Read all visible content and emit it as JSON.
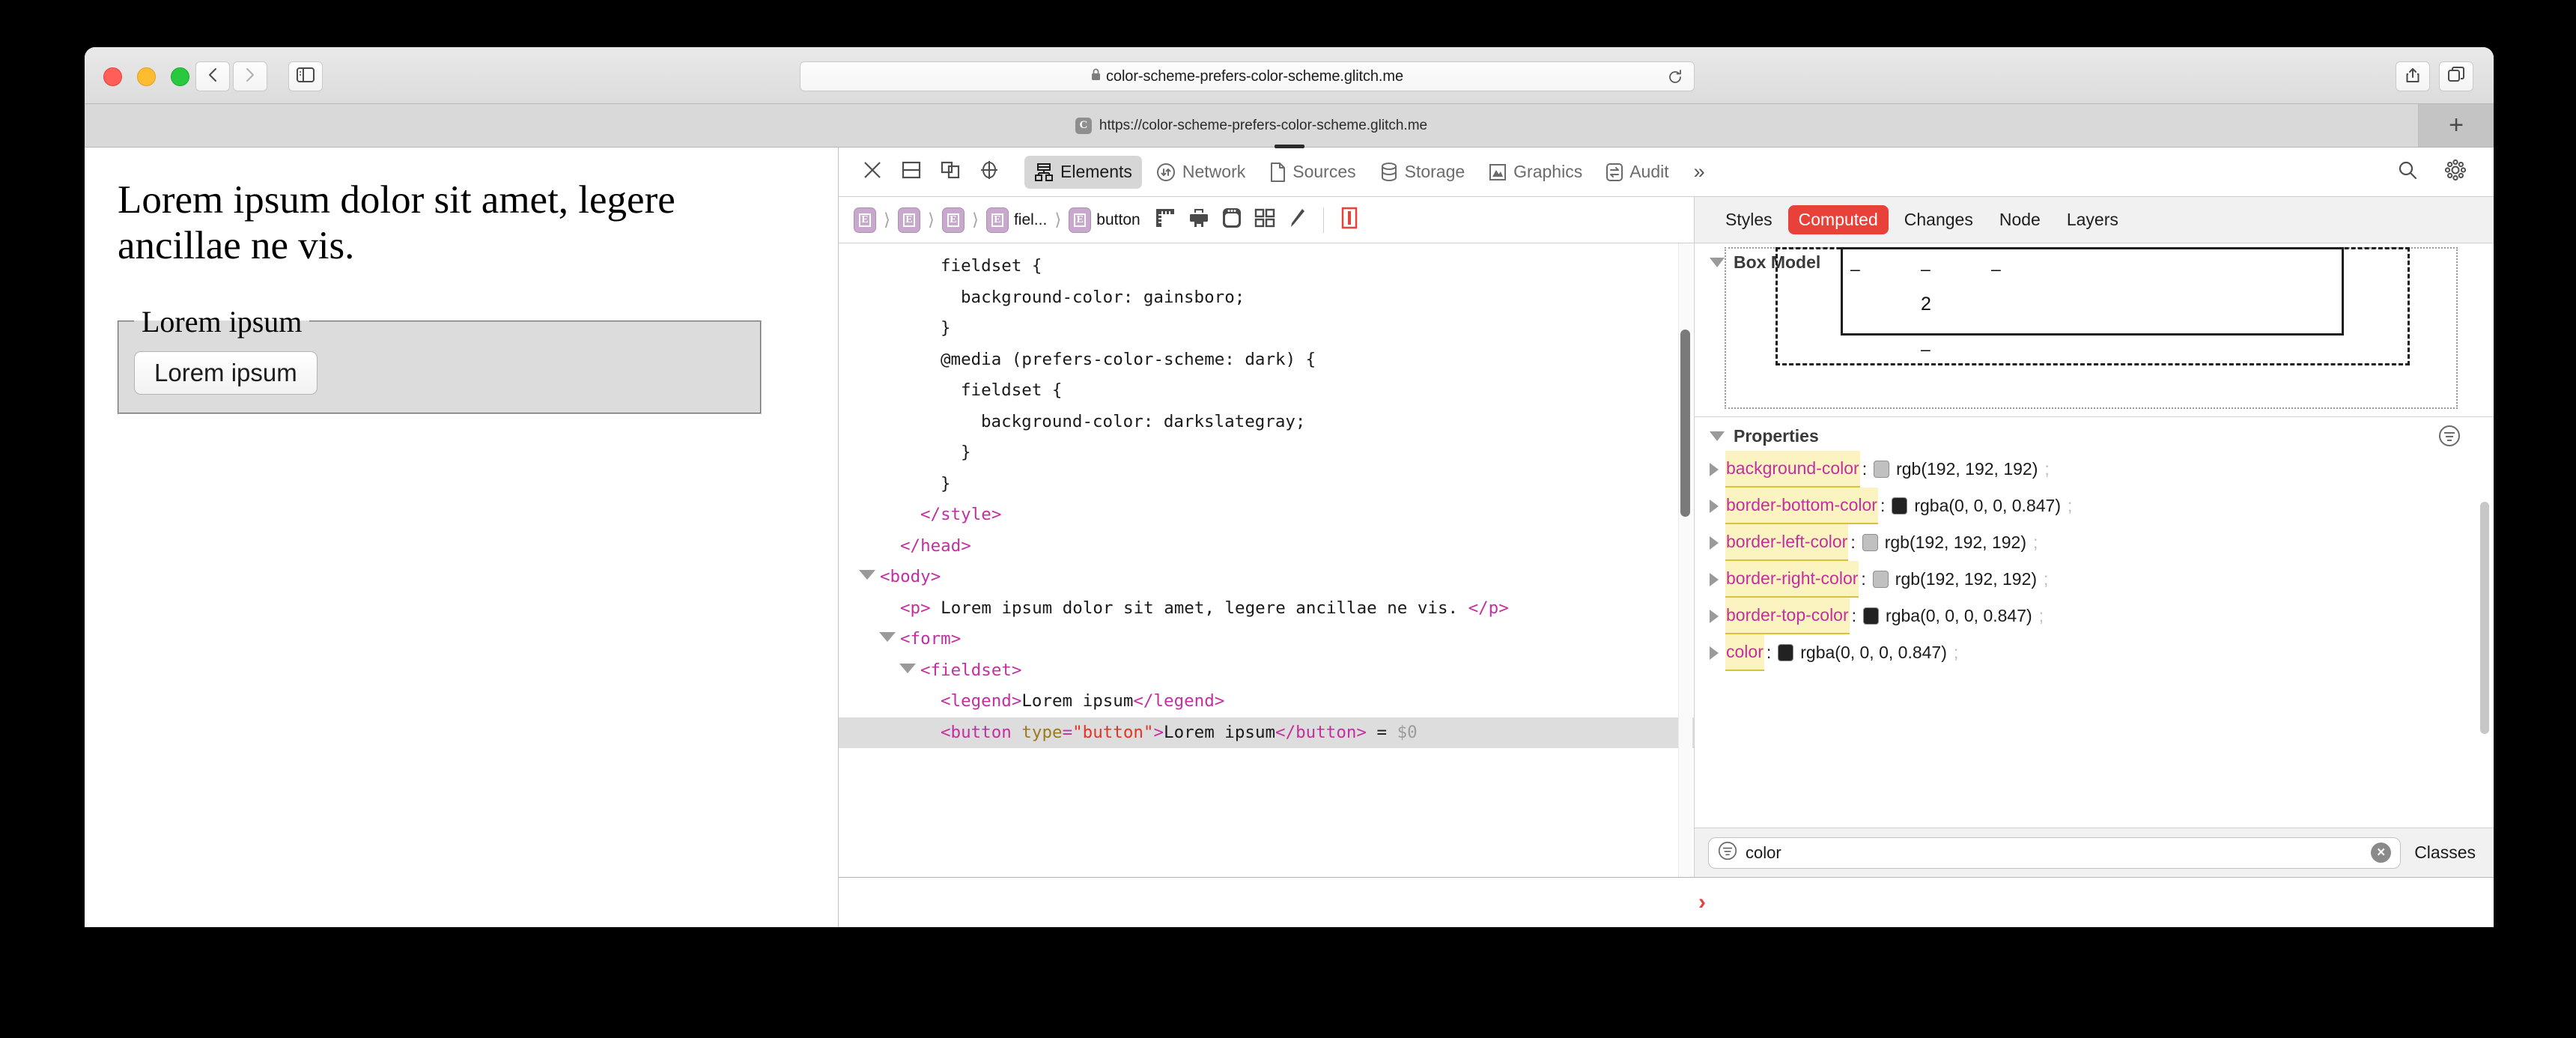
{
  "browser": {
    "address": "color-scheme-prefers-color-scheme.glitch.me",
    "lock_icon": "lock-icon",
    "reload_icon": "reload-icon",
    "back_icon": "chevron-left-icon",
    "forward_icon": "chevron-right-icon",
    "sidebar_icon": "sidebar-toggle-icon",
    "share_icon": "share-icon",
    "tabs_overview_icon": "tab-overview-icon",
    "new_tab_label": "+"
  },
  "tabstrip": {
    "tab": {
      "favicon_letter": "C",
      "title": "https://color-scheme-prefers-color-scheme.glitch.me"
    }
  },
  "page": {
    "paragraph": "Lorem ipsum dolor sit amet, legere ancillae ne vis.",
    "legend": "Lorem ipsum",
    "button_label": "Lorem ipsum"
  },
  "devtools": {
    "toolbar_icons": [
      {
        "name": "close-devtools-icon",
        "glyph": "close"
      },
      {
        "name": "dock-bottom-icon",
        "glyph": "dock-bottom"
      },
      {
        "name": "dock-side-icon",
        "glyph": "dock-side"
      },
      {
        "name": "inspect-element-icon",
        "glyph": "crosshair"
      }
    ],
    "tabs": [
      {
        "label": "Elements",
        "icon": "elements-icon",
        "active": true
      },
      {
        "label": "Network",
        "icon": "network-icon",
        "active": false
      },
      {
        "label": "Sources",
        "icon": "sources-icon",
        "active": false
      },
      {
        "label": "Storage",
        "icon": "storage-icon",
        "active": false
      },
      {
        "label": "Graphics",
        "icon": "graphics-icon",
        "active": false
      },
      {
        "label": "Audit",
        "icon": "audit-icon",
        "active": false
      }
    ],
    "more_label": "»",
    "search_icon": "search-icon",
    "settings_icon": "gear-icon",
    "breadcrumb": [
      {
        "badge": "E",
        "label": ""
      },
      {
        "badge": "E",
        "label": ""
      },
      {
        "badge": "E",
        "label": ""
      },
      {
        "badge": "E",
        "label": "fiel..."
      },
      {
        "badge": "E",
        "label": "button"
      }
    ],
    "breadcrumb_tools": [
      {
        "name": "layout-ruler-icon"
      },
      {
        "name": "print-icon"
      },
      {
        "name": "device-icon"
      },
      {
        "name": "grid-overlay-icon"
      },
      {
        "name": "paintbrush-icon"
      },
      {
        "name": "force-state-icon"
      }
    ],
    "style_tabs": [
      {
        "label": "Styles",
        "active": false
      },
      {
        "label": "Computed",
        "active": true
      },
      {
        "label": "Changes",
        "active": false
      },
      {
        "label": "Node",
        "active": false
      },
      {
        "label": "Layers",
        "active": false
      }
    ],
    "code_lines": [
      {
        "indent": 4,
        "segments": [
          {
            "t": "txt",
            "v": "fieldset {"
          }
        ]
      },
      {
        "indent": 5,
        "segments": [
          {
            "t": "txt",
            "v": "background-color: gainsboro;"
          }
        ]
      },
      {
        "indent": 4,
        "segments": [
          {
            "t": "txt",
            "v": "}"
          }
        ]
      },
      {
        "indent": 4,
        "segments": [
          {
            "t": "txt",
            "v": "@media (prefers-color-scheme: dark) {"
          }
        ]
      },
      {
        "indent": 5,
        "segments": [
          {
            "t": "txt",
            "v": "fieldset {"
          }
        ]
      },
      {
        "indent": 6,
        "segments": [
          {
            "t": "txt",
            "v": "background-color: darkslategray;"
          }
        ]
      },
      {
        "indent": 5,
        "segments": [
          {
            "t": "txt",
            "v": "}"
          }
        ]
      },
      {
        "indent": 4,
        "segments": [
          {
            "t": "txt",
            "v": "}"
          }
        ]
      },
      {
        "indent": 3,
        "segments": [
          {
            "t": "tag",
            "v": "</style>"
          }
        ]
      },
      {
        "indent": 2,
        "segments": [
          {
            "t": "tag",
            "v": "</head>"
          }
        ]
      },
      {
        "indent": 1,
        "triangle": true,
        "segments": [
          {
            "t": "tag",
            "v": "<body>"
          }
        ]
      },
      {
        "indent": 2,
        "segments": [
          {
            "t": "tag",
            "v": "<p>"
          },
          {
            "t": "txt",
            "v": " Lorem ipsum dolor sit amet, legere ancillae ne vis. "
          },
          {
            "t": "tag",
            "v": "</p>"
          }
        ]
      },
      {
        "indent": 2,
        "triangle": true,
        "segments": [
          {
            "t": "tag",
            "v": "<form>"
          }
        ]
      },
      {
        "indent": 3,
        "triangle": true,
        "segments": [
          {
            "t": "tag",
            "v": "<fieldset>"
          }
        ]
      },
      {
        "indent": 4,
        "segments": [
          {
            "t": "tag",
            "v": "<legend>"
          },
          {
            "t": "txt",
            "v": "Lorem ipsum"
          },
          {
            "t": "tag",
            "v": "</legend>"
          }
        ]
      },
      {
        "indent": 4,
        "selected": true,
        "segments": [
          {
            "t": "tag",
            "v": "<button "
          },
          {
            "t": "attr",
            "v": "type"
          },
          {
            "t": "tag",
            "v": "="
          },
          {
            "t": "val",
            "v": "\"button\""
          },
          {
            "t": "tag",
            "v": ">"
          },
          {
            "t": "txt",
            "v": "Lorem ipsum"
          },
          {
            "t": "tag",
            "v": "</button>"
          },
          {
            "t": "txt",
            "v": " = "
          },
          {
            "t": "dollar",
            "v": "$0"
          }
        ]
      }
    ],
    "box_model": {
      "title": "Box Model",
      "margin_top": "–",
      "margin_right": "–",
      "margin_bottom": "–",
      "margin_left": "–",
      "border_top": "–",
      "border_bottom": "2",
      "padding_bottom": "–"
    },
    "properties": {
      "title": "Properties",
      "filter_menu_icon": "filter-menu-icon",
      "rows": [
        {
          "name": "background-color",
          "swatch": "#c0c0c0",
          "value": "rgb(192, 192, 192)"
        },
        {
          "name": "border-bottom-color",
          "swatch": "#222222",
          "value": "rgba(0, 0, 0, 0.847)"
        },
        {
          "name": "border-left-color",
          "swatch": "#c0c0c0",
          "value": "rgb(192, 192, 192)"
        },
        {
          "name": "border-right-color",
          "swatch": "#c0c0c0",
          "value": "rgb(192, 192, 192)"
        },
        {
          "name": "border-top-color",
          "swatch": "#222222",
          "value": "rgba(0, 0, 0, 0.847)"
        },
        {
          "name": "color",
          "swatch": "#222222",
          "value": "rgba(0, 0, 0, 0.847)"
        }
      ]
    },
    "filter": {
      "icon": "filter-icon",
      "value": "color",
      "clear_label": "×",
      "classes_label": "Classes"
    },
    "console_prompt": "›"
  },
  "colors": {
    "accent_red": "#e8413a",
    "tag_magenta": "#c42fa0",
    "attr_gold": "#9b7a1a",
    "value_red": "#e03524",
    "highlight_yellow": "#fbf4c0",
    "badge_purple": "#c9a8cd"
  }
}
